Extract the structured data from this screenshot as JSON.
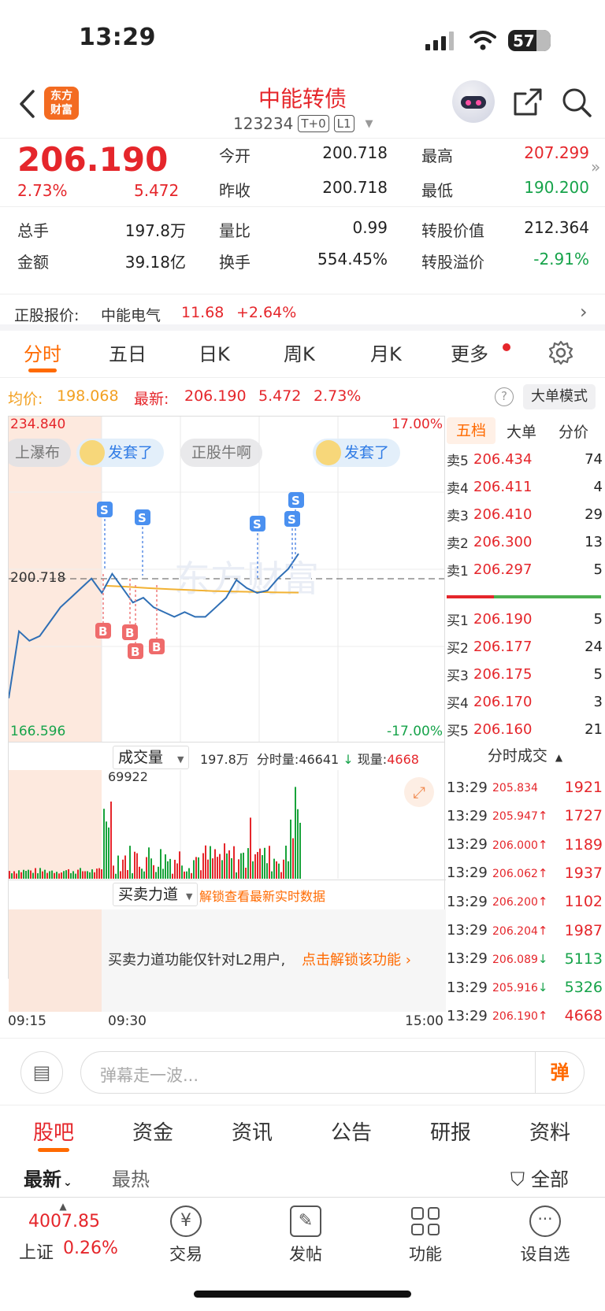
{
  "status": {
    "time": "13:29",
    "battery": "57"
  },
  "header": {
    "logo_line1": "东方",
    "logo_line2": "财富",
    "title": "中能转债",
    "code": "123234",
    "tag1": "T+0",
    "tag2": "L1"
  },
  "quote": {
    "price": "206.190",
    "change_pct": "2.73%",
    "change": "5.472",
    "open_label": "今开",
    "open": "200.718",
    "prev_label": "昨收",
    "prev": "200.718",
    "high_label": "最高",
    "high": "207.299",
    "low_label": "最低",
    "low": "190.200",
    "vol_label": "总手",
    "vol": "197.8万",
    "ratio_label": "量比",
    "ratio": "0.99",
    "conv_val_label": "转股价值",
    "conv_val": "212.364",
    "amt_label": "金额",
    "amt": "39.18亿",
    "turn_label": "换手",
    "turn": "554.45%",
    "premium_label": "转股溢价",
    "premium": "-2.91%"
  },
  "underlying": {
    "label": "正股报价:",
    "name": "中能电气",
    "price": "11.68",
    "change": "+2.64%"
  },
  "kline_tabs": [
    "分时",
    "五日",
    "日K",
    "周K",
    "月K",
    "更多"
  ],
  "chart_info": {
    "avg_label": "均价:",
    "avg": "198.068",
    "latest_label": "最新:",
    "latest": "206.190",
    "latest_change": "5.472",
    "latest_pct": "2.73%",
    "mode_button": "大单模式"
  },
  "chart": {
    "ymax": "234.840",
    "ymin": "166.596",
    "ymid": "200.718",
    "pct_top": "17.00%",
    "pct_bottom": "-17.00%",
    "bubbles": [
      "上瀑布",
      "发套了",
      "正股牛啊",
      "发套了"
    ],
    "watermark": "东方财富",
    "vol_label": "成交量",
    "vol_total": "197.8万",
    "vol_min_label": "分时量:",
    "vol_min": "46641",
    "vol_now_label": "现量:",
    "vol_now": "4668",
    "vol_max": "69922",
    "force_label": "买卖力道",
    "force_unlock": "解锁查看最新实时数据",
    "force_msg": "买卖力道功能仅针对L2用户,",
    "force_link": "点击解锁该功能",
    "t_start": "09:15",
    "t_open": "09:30",
    "t_end": "15:00"
  },
  "chart_data": {
    "type": "line",
    "ylim": [
      166.596,
      234.84
    ],
    "series": [
      {
        "name": "价格",
        "values": [
          176,
          190,
          188,
          189,
          192,
          195,
          197,
          199,
          201,
          198,
          202,
          199,
          196,
          197,
          195,
          194,
          193,
          194,
          193,
          193,
          195,
          197,
          200.7,
          199,
          198,
          198.5,
          201,
          203,
          206.19
        ]
      },
      {
        "name": "均价",
        "values": [
          199.5,
          199.3,
          199.0,
          198.8,
          198.6,
          198.4,
          198.3,
          198.2,
          198.1,
          198.068
        ]
      }
    ]
  },
  "orderbook": {
    "tabs": [
      "五档",
      "大单",
      "分价"
    ],
    "asks": [
      {
        "label": "卖5",
        "price": "206.434",
        "vol": "74"
      },
      {
        "label": "卖4",
        "price": "206.411",
        "vol": "4"
      },
      {
        "label": "卖3",
        "price": "206.410",
        "vol": "29"
      },
      {
        "label": "卖2",
        "price": "206.300",
        "vol": "13"
      },
      {
        "label": "卖1",
        "price": "206.297",
        "vol": "5"
      }
    ],
    "bids": [
      {
        "label": "买1",
        "price": "206.190",
        "vol": "5"
      },
      {
        "label": "买2",
        "price": "206.177",
        "vol": "24"
      },
      {
        "label": "买3",
        "price": "206.175",
        "vol": "5"
      },
      {
        "label": "买4",
        "price": "206.170",
        "vol": "3"
      },
      {
        "label": "买5",
        "price": "206.160",
        "vol": "21"
      }
    ]
  },
  "trades": {
    "title": "分时成交",
    "rows": [
      {
        "time": "13:29",
        "price": "205.834",
        "arrow": "",
        "vol": "1921",
        "dir": "up"
      },
      {
        "time": "13:29",
        "price": "205.947",
        "arrow": "↑",
        "vol": "1727",
        "dir": "up"
      },
      {
        "time": "13:29",
        "price": "206.000",
        "arrow": "↑",
        "vol": "1189",
        "dir": "up"
      },
      {
        "time": "13:29",
        "price": "206.062",
        "arrow": "↑",
        "vol": "1937",
        "dir": "up"
      },
      {
        "time": "13:29",
        "price": "206.200",
        "arrow": "↑",
        "vol": "1102",
        "dir": "up"
      },
      {
        "time": "13:29",
        "price": "206.204",
        "arrow": "↑",
        "vol": "1987",
        "dir": "up"
      },
      {
        "time": "13:29",
        "price": "206.089",
        "arrow": "↓",
        "vol": "5113",
        "dir": "down"
      },
      {
        "time": "13:29",
        "price": "205.916",
        "arrow": "↓",
        "vol": "5326",
        "dir": "down"
      },
      {
        "time": "13:29",
        "price": "206.190",
        "arrow": "↑",
        "vol": "4668",
        "dir": "up"
      }
    ]
  },
  "comment": {
    "placeholder": "弹幕走一波...",
    "send": "弹"
  },
  "bottom_tabs": [
    "股吧",
    "资金",
    "资讯",
    "公告",
    "研报",
    "资料"
  ],
  "feed_filters": {
    "latest": "最新",
    "hot": "最热",
    "all": "全部"
  },
  "nav": {
    "index_value": "4007.85",
    "index_name": "上证",
    "index_change": "0.26%",
    "items": [
      "交易",
      "发帖",
      "功能",
      "设自选"
    ]
  },
  "colors": {
    "up": "#e5262b",
    "down": "#16a34a",
    "accent": "#ff6a00",
    "line": "#2f6fb5",
    "avg": "#f2b233"
  }
}
